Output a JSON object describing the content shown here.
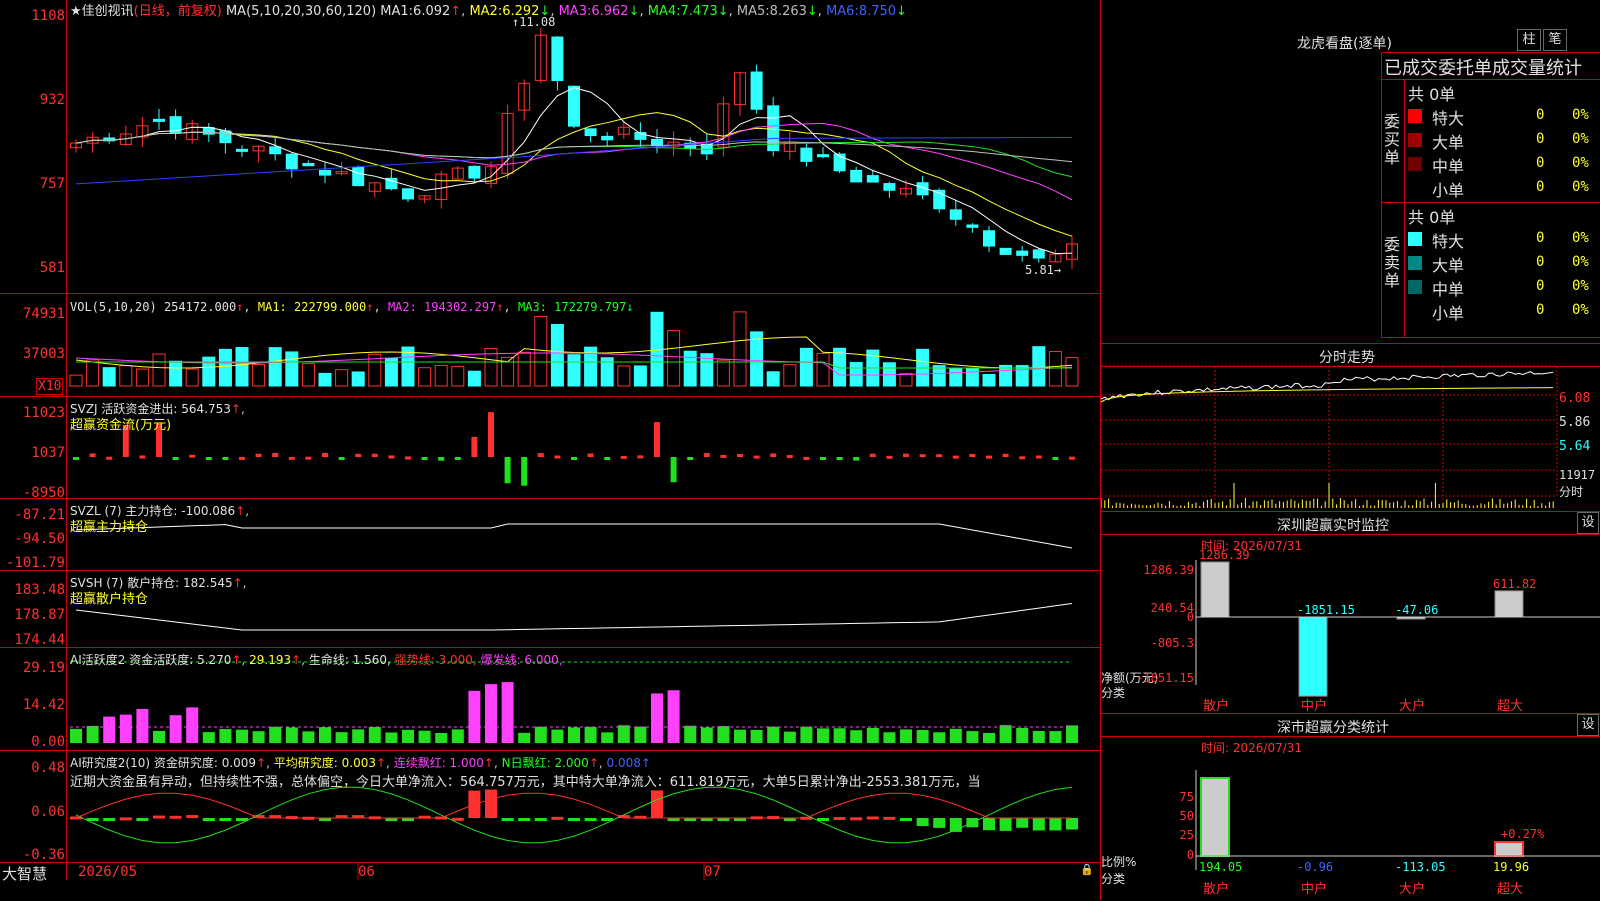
{
  "colors": {
    "up": "#ff3030",
    "down": "#30ffff",
    "grid": "#c00000",
    "ma1": "#ffffff",
    "ma2": "#ffff30",
    "ma3": "#ff40ff",
    "ma4": "#20e020",
    "ma5": "#c0c0c0",
    "ma6": "#3040ff"
  },
  "main": {
    "title": "佳创视讯",
    "mode": "(日线，前复权)",
    "ma_prefix": "MA(5,10,20,30,60,120)",
    "ma": [
      {
        "label": "MA1:",
        "val": "6.092"
      },
      {
        "label": "MA2:",
        "val": "6.292"
      },
      {
        "label": "MA3:",
        "val": "6.962"
      },
      {
        "label": "MA4:",
        "val": "7.473"
      },
      {
        "label": "MA5:",
        "val": "8.263"
      },
      {
        "label": "MA6:",
        "val": "8.750"
      }
    ],
    "high_label": "11.08",
    "low_label": "5.81",
    "axis": [
      "1108",
      "932",
      "757",
      "581"
    ]
  },
  "vol": {
    "prefix": "VOL(5,10,20)",
    "v": "254172.000",
    "ma1": "MA1: 222799.000",
    "ma2": "MA2: 194302.297",
    "ma3": "MA3: 172279.797",
    "axis": [
      "74931",
      "37003"
    ],
    "unit": "X10"
  },
  "svzj": {
    "prefix": "SVZJ  活跃资金进出:",
    "v": "564.753",
    "sub": "超赢资金流(万元)",
    "axis": [
      "11023",
      "1037",
      "-8950"
    ]
  },
  "svzl": {
    "prefix": "SVZL (7) 主力持仓:",
    "v": "-100.086",
    "sub": "超赢主力持仓",
    "axis": [
      "-87.21",
      "-94.50",
      "-101.79"
    ]
  },
  "svsh": {
    "prefix": "SVSH (7) 散户持仓:",
    "v": "182.545",
    "sub": "超赢散户持仓",
    "axis": [
      "183.48",
      "178.87",
      "174.44"
    ]
  },
  "ai1": {
    "prefix": "AI活跃度2 资金活跃度:",
    "v": "5.270",
    "v2": "29.193",
    "life": "生命线: 1.560,",
    "strong": "强势线: 3.000,",
    "burst": "爆发线: 6.000,",
    "axis": [
      "29.19",
      "14.42",
      "0.00"
    ]
  },
  "ai2": {
    "prefix": "AI研究度2(10) 资金研究度:",
    "v": "0.009",
    "avg": "平均研究度: 0.003",
    "red": "连续飘红: 1.000",
    "nred": "N日飘红: 2.000",
    "last": "0.008",
    "commentary": "近期大资金虽有异动，但持续性不强，总体偏空，今日大单净流入：564.757万元，其中特大单净流入：611.819万元，大单5日累计净出-2553.381万元，当",
    "axis": [
      "0.48",
      "0.06",
      "-0.36"
    ]
  },
  "bottom": {
    "brand": "大智慧",
    "dates": [
      "2026/05",
      "06",
      "07"
    ]
  },
  "right": {
    "lhb_title": "龙虎看盘(逐单)",
    "btn1": "柱",
    "btn2": "笔",
    "stat_title": "已成交委托单成交量统计",
    "buy_side": "委买单",
    "sell_side": "委卖单",
    "buy_total": "共 0单",
    "sell_total": "共 0单",
    "rows": [
      {
        "name": "特大",
        "n": "0",
        "pct": "0%",
        "buy": "#ff0000",
        "sell": "#30ffff"
      },
      {
        "name": "大单",
        "n": "0",
        "pct": "0%",
        "buy": "#a00000",
        "sell": "#008888"
      },
      {
        "name": "中单",
        "n": "0",
        "pct": "0%",
        "buy": "#700000",
        "sell": "#006666"
      },
      {
        "name": "小单",
        "n": "0",
        "pct": "0%",
        "buy": "",
        "sell": ""
      }
    ],
    "fs_title": "分时走势",
    "fs_axis": [
      "6.08",
      "5.86",
      "5.64",
      "11917"
    ],
    "fs_unit": "分时",
    "sz_title": "深圳超赢实时监控",
    "sz_btn": "设",
    "sz_time": "时间: 2026/07/31",
    "sz_axis": [
      "1286.39",
      "240.54",
      "0",
      "-805.3",
      "-1851.15"
    ],
    "sz_bars": [
      {
        "cat": "散户",
        "value": 1286.39,
        "label": "1286.39"
      },
      {
        "cat": "中户",
        "value": -1851.15,
        "label": "-1851.15"
      },
      {
        "cat": "大户",
        "value": -47.06,
        "label": "-47.06"
      },
      {
        "cat": "超大",
        "value": 611.82,
        "label": "611.82"
      }
    ],
    "sz_unit": "净额(万元)",
    "sz_cls": "分类",
    "ss_title": "深市超赢分类统计",
    "ss_btn": "设",
    "ss_time": "时间: 2026/07/31",
    "ss_axis": [
      "75",
      "50",
      "25",
      "0"
    ],
    "ss_vals": [
      "194.05",
      "-0.96",
      "-113.05",
      "19.96"
    ],
    "ss_pct": "+0.27%",
    "ss_unit": "比例%",
    "ss_cls": "分类",
    "cats": [
      "散户",
      "中户",
      "大户",
      "超大"
    ]
  }
}
